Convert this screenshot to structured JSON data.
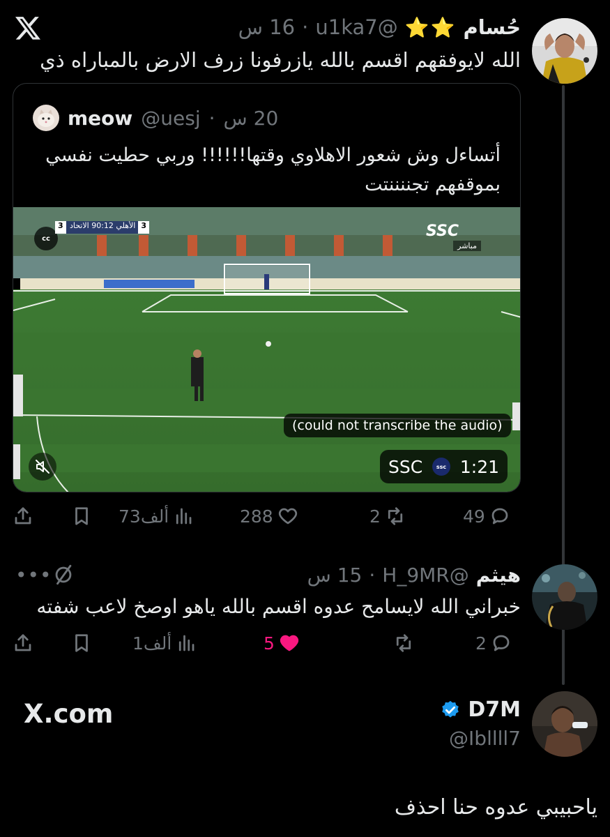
{
  "tweet1": {
    "name": "حُسام",
    "stars": "⭐⭐",
    "handle": "@u1ka7",
    "time": "16 س",
    "text": "الله لايوفقهم اقسم بالله يازرفونا زرف الارض بالمباراه ذي"
  },
  "quote": {
    "name": "meow",
    "handle": "@uesj",
    "time": "20 س",
    "text_line1": "أتساءل وش شعور الاهلاوي وقتها!!!!!! وربي حطيت نفسي",
    "text_line2": "بموقفهم تجننننتت",
    "video": {
      "cc_label": "cc",
      "score_home": "3",
      "teams_time": "الأهلي 90:12 الاتحاد",
      "score_away": "3",
      "broadcaster": "SSC",
      "live_label": "مباشر",
      "caption": "(could not transcribe the audio)",
      "channel": "SSC",
      "channel_badge": "ssc",
      "duration": "1:21"
    }
  },
  "actions1": {
    "replies": "49",
    "reposts": "2",
    "likes": "288",
    "views": "73ألف"
  },
  "tweet2": {
    "name": "هيثم",
    "handle": "@H_9MR",
    "time": "15 س",
    "text": "خبراني الله لايسامح عدوه اقسم بالله ياهو اوصخ لاعب شفته",
    "more": "•••"
  },
  "actions2": {
    "replies": "2",
    "reposts": "",
    "likes": "5",
    "views": "1ألف"
  },
  "bottom": {
    "brand": "X.com",
    "name": "D7M",
    "handle": "@Ibllll7",
    "text": "ياحبيبي عدوه حنا احذف"
  },
  "colors": {
    "background": "#000000",
    "text": "#e7e9ea",
    "muted": "#71767b",
    "like": "#f91880",
    "verified": "#1d9bf0"
  }
}
